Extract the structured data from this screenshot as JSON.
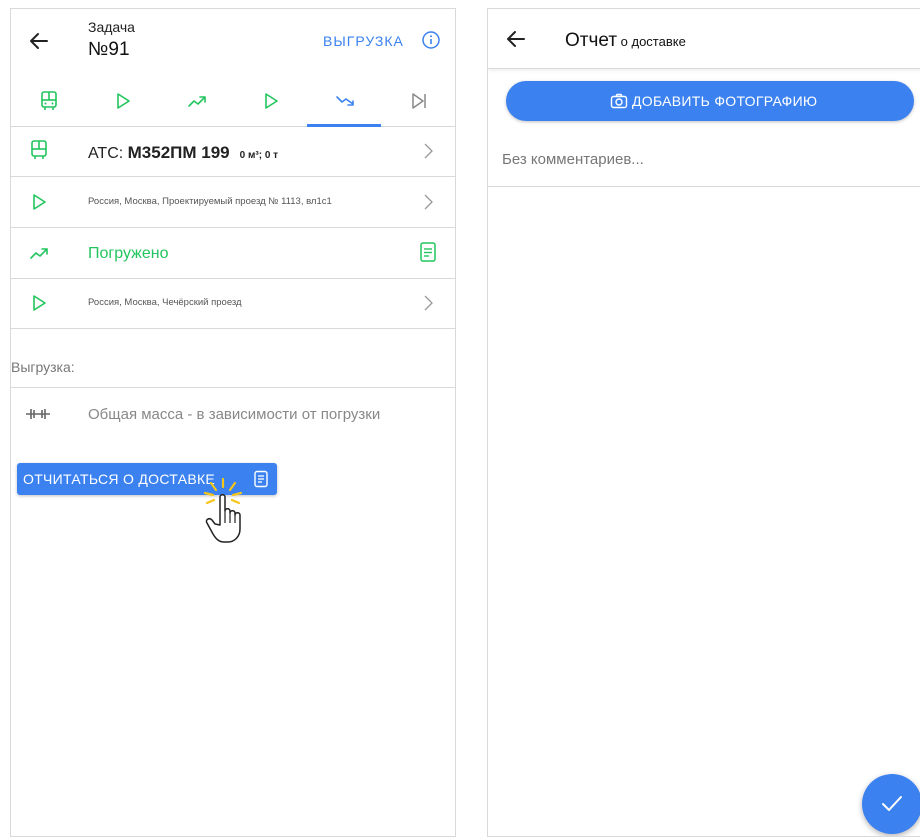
{
  "left": {
    "header": {
      "title_small": "Задача",
      "title_big": "№91",
      "unload_label": "ВЫГРУЗКА"
    },
    "tabs": [
      "bus-icon",
      "play-icon",
      "trend-up-icon",
      "play-icon",
      "trend-down-icon",
      "skip-end-icon"
    ],
    "rows": {
      "ats_prefix": "АТС: ",
      "ats_plate": "М352ПМ 199",
      "ats_capacity": "0 м³; 0 т",
      "address1": "Россия, Москва, Проектируемый проезд № 1113, вл1с1",
      "loaded": "Погружено",
      "address2": "Россия, Москва, Чечёрский проезд"
    },
    "section_label": "Выгрузка:",
    "mass_text": "Общая масса - в зависимости от погрузки",
    "report_button": "ОТЧИТАТЬСЯ О ДОСТАВКЕ"
  },
  "right": {
    "title_main": "Отчет",
    "title_sub": " о доставке",
    "add_photo": "ДОБАВИТЬ ФОТОГРАФИЮ",
    "comment_placeholder": "Без комментариев..."
  },
  "colors": {
    "accent": "#3b82f0",
    "success": "#22c55e"
  }
}
